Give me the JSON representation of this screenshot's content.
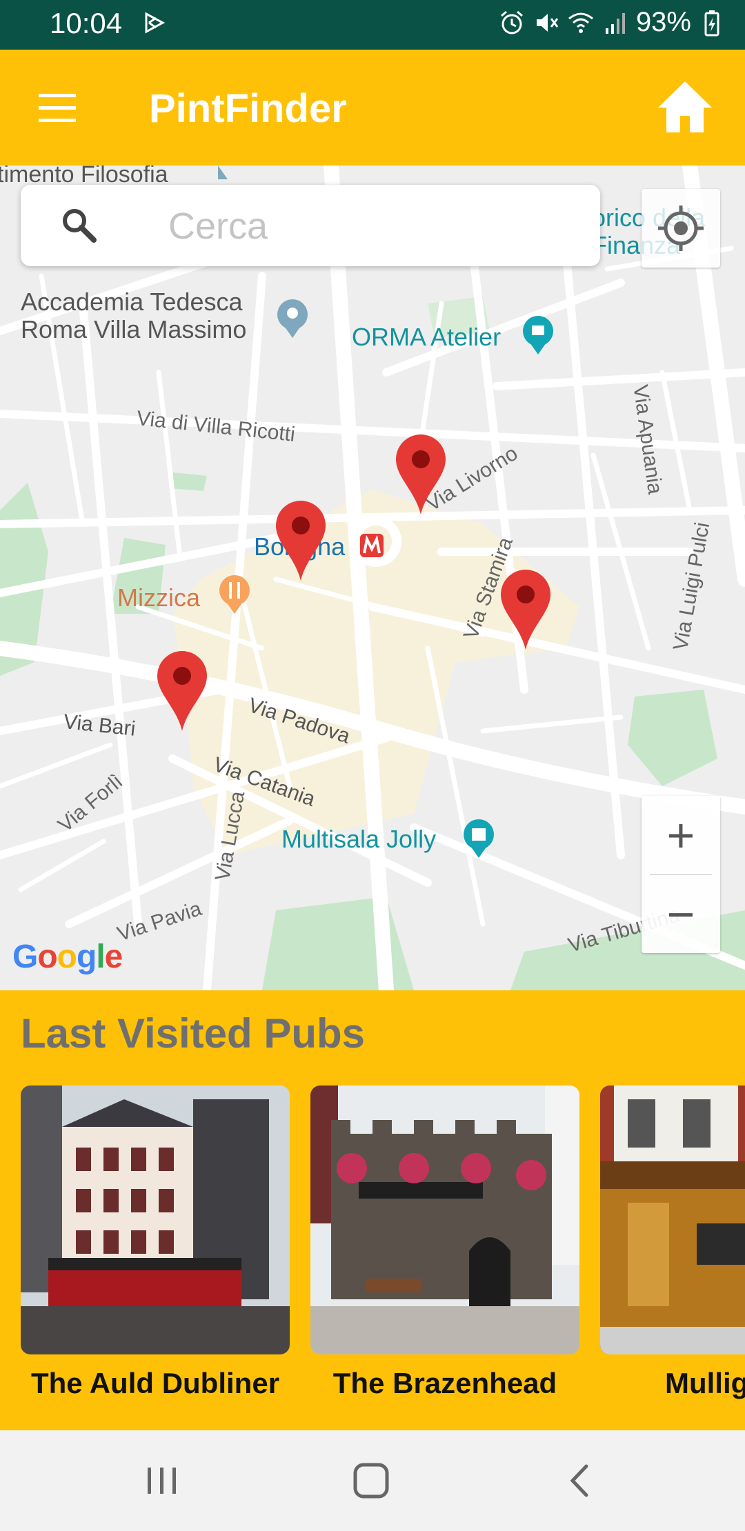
{
  "status_bar": {
    "time": "10:04",
    "battery": "93%",
    "icons": [
      "play-store-icon",
      "alarm-icon",
      "mute-icon",
      "wifi-icon",
      "signal-icon",
      "battery-icon"
    ]
  },
  "app_bar": {
    "title": "PintFinder",
    "menu_icon": "menu-icon",
    "home_icon": "home-icon",
    "color": "#ffc107"
  },
  "map": {
    "search_placeholder": "Cerca",
    "labels": {
      "filosofia": "timento Filosofia",
      "accademia": "Accademia Tedesca\nRoma Villa Massimo",
      "orma": "ORMA Atelier",
      "finanza": "orico della\nFinanza",
      "villa_ricotti": "Via di Villa Ricotti",
      "via_livorno": "Via Livorno",
      "via_apuania": "Via Apuania",
      "bologna": "Bologna",
      "mizzica": "Mizzica",
      "via_stamira": "Via Stamira",
      "via_luigi_pulci": "Via Luigi Pulci",
      "via_bari": "Via Bari",
      "via_padova": "Via Padova",
      "via_catania": "Via Catania",
      "via_forli": "Via Forlì",
      "via_lucca": "Via Lucca",
      "multisala": "Multisala Jolly",
      "via_pavia": "Via Pavia",
      "via_tiburtina": "Via Tiburtina"
    },
    "zoom_in": "+",
    "zoom_out": "−",
    "google": [
      "G",
      "o",
      "o",
      "g",
      "l",
      "e"
    ],
    "marker_color": "#e53935",
    "marker_count": 4
  },
  "last_visited": {
    "title": "Last Visited Pubs",
    "pubs": [
      {
        "name": "The Auld Dubliner"
      },
      {
        "name": "The Brazenhead"
      },
      {
        "name": "Mullig"
      }
    ]
  },
  "nav_bar": {
    "buttons": [
      "recent-apps-icon",
      "home-button-icon",
      "back-icon"
    ]
  }
}
